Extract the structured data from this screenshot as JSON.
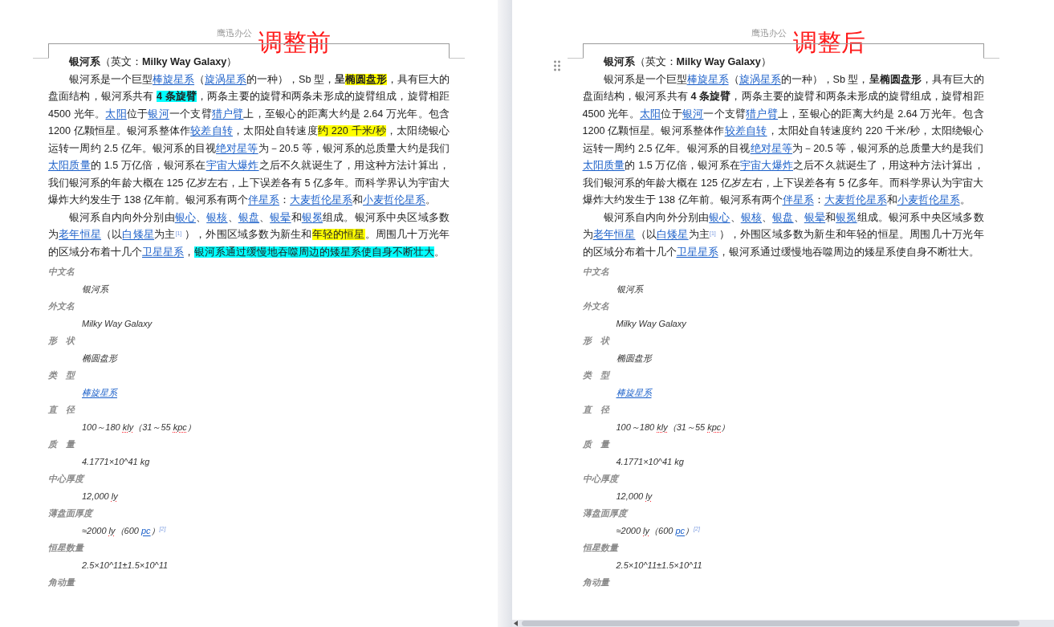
{
  "panes": [
    {
      "header": "鹰迅办公",
      "annotation": "调整前",
      "drag_handle": false,
      "paragraphs": [
        {
          "indent": true,
          "segments": [
            {
              "text": "银河系",
              "kind": "bold"
            },
            {
              "text": "（英文："
            },
            {
              "text": "Milky Way Galaxy",
              "kind": "bold"
            },
            {
              "text": "）"
            }
          ]
        },
        {
          "indent": true,
          "segments": [
            {
              "text": "银河系是一个巨型"
            },
            {
              "text": "棒旋星系",
              "kind": "link"
            },
            {
              "text": "（"
            },
            {
              "text": "旋涡星系",
              "kind": "link"
            },
            {
              "text": "的一种），Sb 型，"
            },
            {
              "text": "呈",
              "kind": "bold"
            },
            {
              "text": "椭圆盘形",
              "kind": "bold",
              "color": "#ffff00"
            },
            {
              "text": "，具有巨大的盘面结构，银河系共有 "
            },
            {
              "text": "4 条旋臂",
              "kind": "bold",
              "color": "#00ffff"
            },
            {
              "text": "，两条主要的旋臂和两条未形成的旋臂组成，旋臂相距 4500 光年。"
            },
            {
              "text": "太阳",
              "kind": "link"
            },
            {
              "text": "位于"
            },
            {
              "text": "银河",
              "kind": "link"
            },
            {
              "text": "一个支臂"
            },
            {
              "text": "猎户臂",
              "kind": "link"
            },
            {
              "text": "上，至银心的距离大约是 2.64 万光年。包含 1200 亿颗恒星。银河系整体作"
            },
            {
              "text": "较差自转",
              "kind": "link"
            },
            {
              "text": "，太阳处自转速度"
            },
            {
              "text": "约 220 千米/秒",
              "color": "#ffff00"
            },
            {
              "text": "，太阳绕银心运转一周约 2.5 亿年。银河系的目视"
            },
            {
              "text": "绝对星等",
              "kind": "link"
            },
            {
              "text": "为－20.5 等，银河系的总质量大约是我们"
            },
            {
              "text": "太阳质量",
              "kind": "link"
            },
            {
              "text": "的 1.5 万亿倍，银河系在"
            },
            {
              "text": "宇宙大爆炸",
              "kind": "link"
            },
            {
              "text": "之后不久就诞生了，用这种方法计算出，我们银河系的年龄大概在 125 亿岁左右，上下误差各有 5 亿多年。而科学界认为宇宙大爆炸大约发生于 138 亿年前。银河系有两个"
            },
            {
              "text": "伴星系",
              "kind": "link"
            },
            {
              "text": "："
            },
            {
              "text": "大麦哲伦星系",
              "kind": "link"
            },
            {
              "text": "和"
            },
            {
              "text": "小麦哲伦星系",
              "kind": "link"
            },
            {
              "text": "。"
            }
          ]
        },
        {
          "indent": true,
          "segments": [
            {
              "text": "银河系自内向外分别由"
            },
            {
              "text": "银心",
              "kind": "link"
            },
            {
              "text": "、"
            },
            {
              "text": "银核",
              "kind": "link"
            },
            {
              "text": "、"
            },
            {
              "text": "银盘",
              "kind": "link"
            },
            {
              "text": "、"
            },
            {
              "text": "银晕",
              "kind": "link"
            },
            {
              "text": "和"
            },
            {
              "text": "银冕",
              "kind": "link"
            },
            {
              "text": "组成。银河系中央区域多数为"
            },
            {
              "text": "老年恒星",
              "kind": "link"
            },
            {
              "text": "（以"
            },
            {
              "text": "白矮星",
              "kind": "link"
            },
            {
              "text": "为主"
            },
            {
              "text": "[1]",
              "kind": "note"
            },
            {
              "text": " ），外围区域多数为新生和"
            },
            {
              "text": "年轻的恒星",
              "color": "#ffff00"
            },
            {
              "text": "。周围几十万光年的区域分布着十几个"
            },
            {
              "text": "卫星星系",
              "kind": "link"
            },
            {
              "text": "，"
            },
            {
              "text": "银河系通过缓慢地吞噬周边的矮星系使自身不断壮大",
              "color": "#00ffff"
            },
            {
              "text": "。"
            }
          ]
        }
      ],
      "infobox": [
        {
          "label": "中文名",
          "value": [
            {
              "text": "银河系"
            }
          ]
        },
        {
          "label": "外文名",
          "value": [
            {
              "text": "Milky Way Galaxy"
            }
          ]
        },
        {
          "label": "形　状",
          "value": [
            {
              "text": "椭圆盘形"
            }
          ]
        },
        {
          "label": "类　型",
          "value": [
            {
              "text": "棒旋星系",
              "kind": "link"
            }
          ]
        },
        {
          "label": "直　径",
          "value": [
            {
              "text": "100～180 "
            },
            {
              "text": "kly",
              "kind": "spell"
            },
            {
              "text": "（31～55 "
            },
            {
              "text": "kpc",
              "kind": "spell"
            },
            {
              "text": "）"
            }
          ]
        },
        {
          "label": "质　量",
          "value": [
            {
              "text": "4.1771×10^41 kg"
            }
          ]
        },
        {
          "label": "中心厚度",
          "value": [
            {
              "text": "12,000 "
            },
            {
              "text": "ly",
              "kind": "spell"
            }
          ]
        },
        {
          "label": "薄盘面厚度",
          "value": [
            {
              "text": "≈2000 "
            },
            {
              "text": "ly",
              "kind": "spell"
            },
            {
              "text": "（600 "
            },
            {
              "text": "pc",
              "kind": "link"
            },
            {
              "text": "）"
            },
            {
              "text": "[2]",
              "kind": "note"
            }
          ]
        },
        {
          "label": "恒星数量",
          "value": [
            {
              "text": "2.5×10^11±1.5×10^11"
            }
          ]
        },
        {
          "label": "角动量"
        }
      ]
    },
    {
      "header": "鹰迅办公",
      "annotation": "调整后",
      "drag_handle": true,
      "paragraphs": [
        {
          "indent": true,
          "segments": [
            {
              "text": "银河系",
              "kind": "bold"
            },
            {
              "text": "（英文："
            },
            {
              "text": "Milky Way Galaxy",
              "kind": "bold"
            },
            {
              "text": "）"
            }
          ]
        },
        {
          "indent": true,
          "segments": [
            {
              "text": "银河系是一个巨型"
            },
            {
              "text": "棒旋星系",
              "kind": "link"
            },
            {
              "text": "（"
            },
            {
              "text": "旋涡星系",
              "kind": "link"
            },
            {
              "text": "的一种），Sb 型，"
            },
            {
              "text": "呈椭圆盘形",
              "kind": "bold"
            },
            {
              "text": "，具有巨大的盘面结构，银河系共有 "
            },
            {
              "text": "4 条旋臂",
              "kind": "bold"
            },
            {
              "text": "，两条主要的旋臂和两条未形成的旋臂组成，旋臂相距 4500 光年。"
            },
            {
              "text": "太阳",
              "kind": "link"
            },
            {
              "text": "位于"
            },
            {
              "text": "银河",
              "kind": "link"
            },
            {
              "text": "一个支臂"
            },
            {
              "text": "猎户臂",
              "kind": "link"
            },
            {
              "text": "上，至银心的距离大约是 2.64 万光年。包含 1200 亿颗恒星。银河系整体作"
            },
            {
              "text": "较差自转",
              "kind": "link"
            },
            {
              "text": "，太阳处自转速度约 220 千米/秒，太阳绕银心运转一周约 2.5 亿年。银河系的目视"
            },
            {
              "text": "绝对星等",
              "kind": "link"
            },
            {
              "text": "为－20.5 等，银河系的总质量大约是我们"
            },
            {
              "text": "太阳质量",
              "kind": "link"
            },
            {
              "text": "的 1.5 万亿倍，银河系在"
            },
            {
              "text": "宇宙大爆炸",
              "kind": "link"
            },
            {
              "text": "之后不久就诞生了，用这种方法计算出，我们银河系的年龄大概在 125 亿岁左右，上下误差各有 5 亿多年。而科学界认为宇宙大爆炸大约发生于 138 亿年前。银河系有两个"
            },
            {
              "text": "伴星系",
              "kind": "link"
            },
            {
              "text": "："
            },
            {
              "text": "大麦哲伦星系",
              "kind": "link"
            },
            {
              "text": "和"
            },
            {
              "text": "小麦哲伦星系",
              "kind": "link"
            },
            {
              "text": "。"
            }
          ]
        },
        {
          "indent": true,
          "segments": [
            {
              "text": "银河系自内向外分别由"
            },
            {
              "text": "银心",
              "kind": "link"
            },
            {
              "text": "、"
            },
            {
              "text": "银核",
              "kind": "link"
            },
            {
              "text": "、"
            },
            {
              "text": "银盘",
              "kind": "link"
            },
            {
              "text": "、"
            },
            {
              "text": "银晕",
              "kind": "link"
            },
            {
              "text": "和"
            },
            {
              "text": "银冕",
              "kind": "link"
            },
            {
              "text": "组成。银河系中央区域多数为"
            },
            {
              "text": "老年恒星",
              "kind": "link"
            },
            {
              "text": "（以"
            },
            {
              "text": "白矮星",
              "kind": "link"
            },
            {
              "text": "为主"
            },
            {
              "text": "[1]",
              "kind": "note"
            },
            {
              "text": " ），外围区域多数为新生和年轻的恒星。周围几十万光年的区域分布着十几个"
            },
            {
              "text": "卫星星系",
              "kind": "link"
            },
            {
              "text": "，银河系通过缓慢地吞噬周边的矮星系使自身不断壮大。"
            }
          ]
        }
      ],
      "infobox": [
        {
          "label": "中文名",
          "value": [
            {
              "text": "银河系"
            }
          ]
        },
        {
          "label": "外文名",
          "value": [
            {
              "text": "Milky Way Galaxy"
            }
          ]
        },
        {
          "label": "形　状",
          "value": [
            {
              "text": "椭圆盘形"
            }
          ]
        },
        {
          "label": "类　型",
          "value": [
            {
              "text": "棒旋星系",
              "kind": "link"
            }
          ]
        },
        {
          "label": "直　径",
          "value": [
            {
              "text": "100～180 "
            },
            {
              "text": "kly",
              "kind": "spell"
            },
            {
              "text": "（31～55 "
            },
            {
              "text": "kpc",
              "kind": "spell"
            },
            {
              "text": "）"
            }
          ]
        },
        {
          "label": "质　量",
          "value": [
            {
              "text": "4.1771×10^41 kg"
            }
          ]
        },
        {
          "label": "中心厚度",
          "value": [
            {
              "text": "12,000 "
            },
            {
              "text": "ly",
              "kind": "spell"
            }
          ]
        },
        {
          "label": "薄盘面厚度",
          "value": [
            {
              "text": "≈2000 "
            },
            {
              "text": "ly",
              "kind": "spell"
            },
            {
              "text": "（600 "
            },
            {
              "text": "pc",
              "kind": "link"
            },
            {
              "text": "）"
            },
            {
              "text": "[2]",
              "kind": "note"
            }
          ]
        },
        {
          "label": "恒星数量",
          "value": [
            {
              "text": "2.5×10^11±1.5×10^11"
            }
          ]
        },
        {
          "label": "角动量"
        }
      ]
    }
  ]
}
